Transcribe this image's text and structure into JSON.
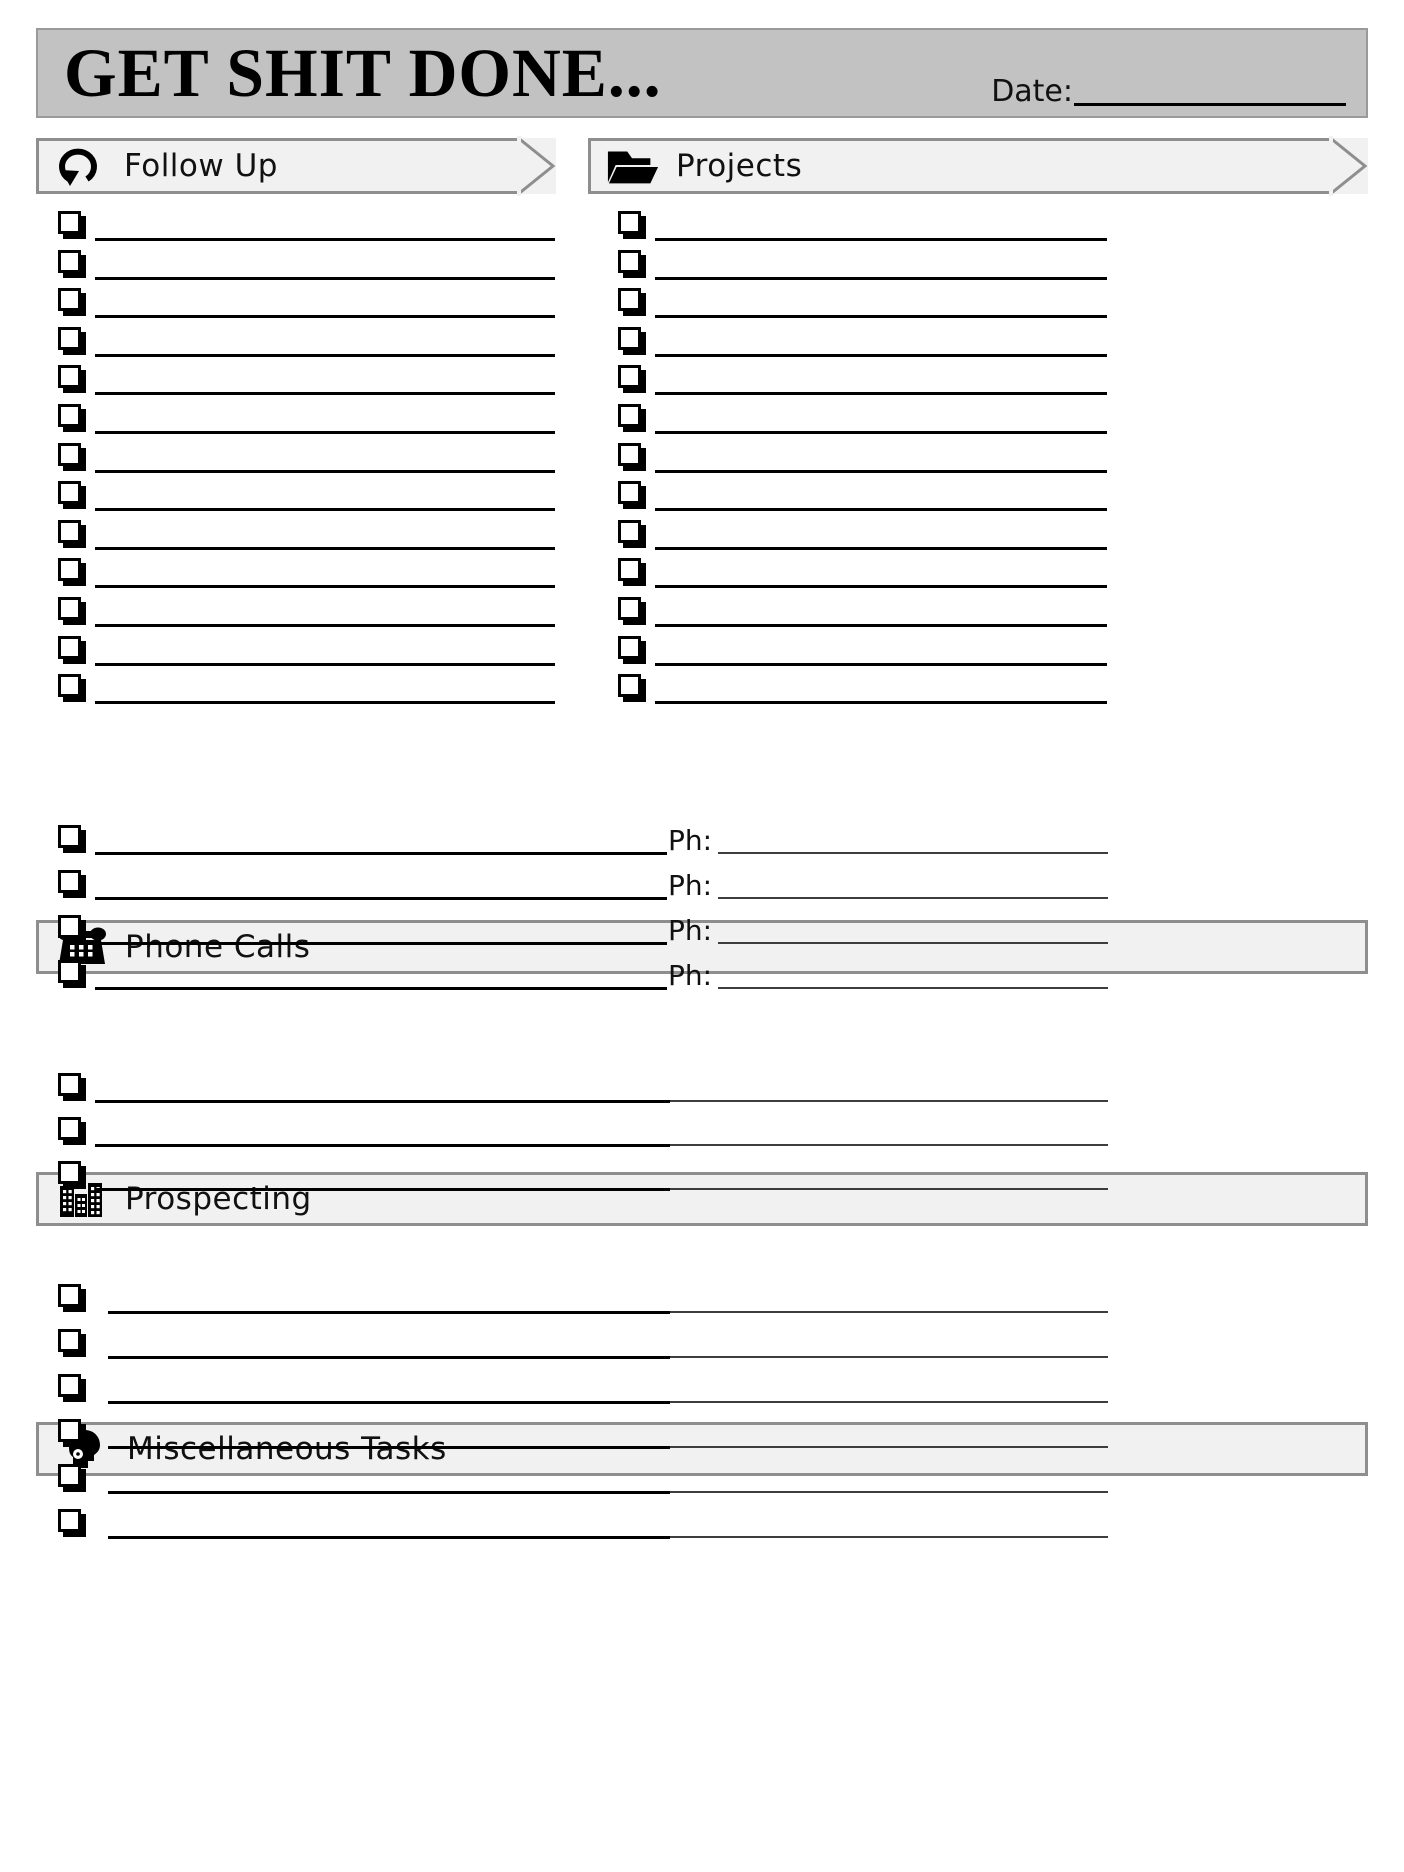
{
  "page": {
    "title": "GET SHIT DONE...",
    "date_label": "Date:",
    "date_value": ""
  },
  "sections": [
    {
      "id": "follow-up",
      "label": "Follow Up",
      "icon": "undo-arrow-icon",
      "rows": 13,
      "style": "chevron"
    },
    {
      "id": "projects",
      "label": "Projects",
      "icon": "folder-icon",
      "rows": 13,
      "style": "chevron"
    },
    {
      "id": "phone-calls",
      "label": "Phone Calls",
      "icon": "telephone-icon",
      "rows": 4,
      "style": "flat",
      "sub_label": "Ph:"
    },
    {
      "id": "prospecting",
      "label": "Prospecting",
      "icon": "office-buildings-icon",
      "rows": 3,
      "style": "flat"
    },
    {
      "id": "miscellaneous-tasks",
      "label": "Miscellaneous Tasks",
      "icon": "head-with-gears-icon",
      "rows": 6,
      "style": "flat"
    }
  ],
  "colors": {
    "title_bar_fill": "#c2c2c2",
    "banner_fill": "#f1f1f1",
    "banner_border": "#8e8e8e",
    "rule": "#000000",
    "page_background": "#ffffff"
  },
  "entries": {
    "follow_up": [
      "",
      "",
      "",
      "",
      "",
      "",
      "",
      "",
      "",
      "",
      "",
      "",
      ""
    ],
    "projects": [
      "",
      "",
      "",
      "",
      "",
      "",
      "",
      "",
      "",
      "",
      "",
      "",
      ""
    ],
    "phone_calls": [
      {
        "name": "",
        "phone": ""
      },
      {
        "name": "",
        "phone": ""
      },
      {
        "name": "",
        "phone": ""
      },
      {
        "name": "",
        "phone": ""
      }
    ],
    "prospecting": [
      "",
      "",
      ""
    ],
    "miscellaneous_tasks": [
      "",
      "",
      "",
      "",
      "",
      ""
    ]
  }
}
